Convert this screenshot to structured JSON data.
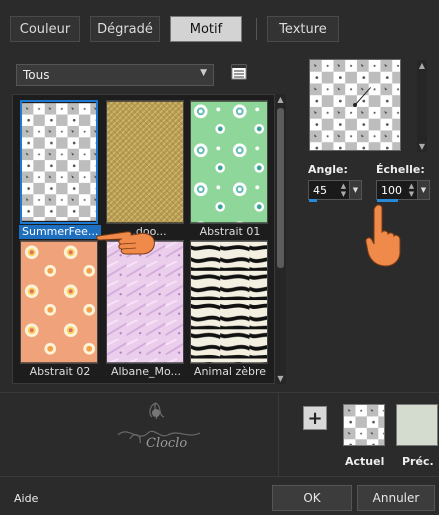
{
  "tabs": [
    {
      "label": "Couleur",
      "active": false
    },
    {
      "label": "Dégradé",
      "active": false
    },
    {
      "label": "Motif",
      "active": true
    },
    {
      "label": "Texture",
      "active": false
    }
  ],
  "category": {
    "selected": "Tous"
  },
  "gallery": {
    "items": [
      {
        "label": "SummerFee...",
        "selected": true
      },
      {
        "label": "...doo...",
        "selected": false
      },
      {
        "label": "Abstrait 01",
        "selected": false
      },
      {
        "label": "Abstrait 02",
        "selected": false
      },
      {
        "label": "Albane_Mo...",
        "selected": false
      },
      {
        "label": "Animal zèbre",
        "selected": false
      }
    ]
  },
  "angle": {
    "label": "Angle:",
    "value": "45"
  },
  "scale": {
    "label": "Échelle:",
    "value": "100"
  },
  "swatches": {
    "current_label": "Actuel",
    "previous_label": "Préc."
  },
  "footer": {
    "help_label": "Aide",
    "ok_label": "OK",
    "cancel_label": "Annuler"
  },
  "watermark": {
    "text": "Cloclo"
  },
  "colors": {
    "accent": "#1e7ad1",
    "background": "#2b2b2b",
    "previous_swatch": "#d4dccf",
    "abstract01_bg": "#8fd69a",
    "abstract02_bg": "#f0a37a",
    "albane_bg": "#e6c3e8"
  }
}
